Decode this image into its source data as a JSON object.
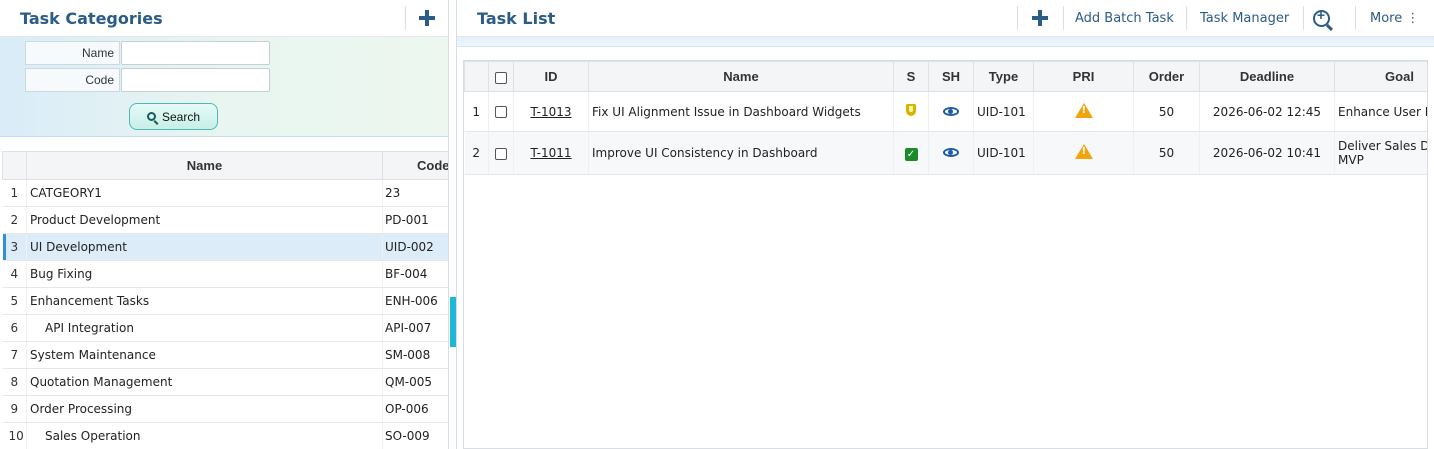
{
  "left_panel": {
    "title": "Task Categories",
    "add_icon": "plus-icon",
    "filters": [
      {
        "label": "Name",
        "value": ""
      },
      {
        "label": "Code",
        "value": ""
      }
    ],
    "search_label": "Search",
    "table": {
      "columns": [
        "Name",
        "Code"
      ],
      "selected_row": 3,
      "rows": [
        {
          "num": "1",
          "name": "CATGEORY1",
          "code": "23"
        },
        {
          "num": "2",
          "name": "Product Development",
          "code": "PD-001"
        },
        {
          "num": "3",
          "name": "UI Development",
          "code": "UID-002"
        },
        {
          "num": "4",
          "name": "Bug Fixing",
          "code": "BF-004"
        },
        {
          "num": "5",
          "name": "Enhancement Tasks",
          "code": "ENH-006"
        },
        {
          "num": "6",
          "name": "API Integration",
          "code": "API-007"
        },
        {
          "num": "7",
          "name": "System Maintenance",
          "code": "SM-008"
        },
        {
          "num": "8",
          "name": "Quotation Management",
          "code": "QM-005"
        },
        {
          "num": "9",
          "name": "Order Processing",
          "code": "OP-006"
        },
        {
          "num": "10",
          "name": "Sales Operation",
          "code": "SO-009"
        }
      ]
    }
  },
  "right_panel": {
    "title": "Task List",
    "toolbar": {
      "add_icon": "plus-icon",
      "add_batch": "Add Batch Task",
      "task_manager": "Task Manager",
      "zoom_icon": "zoom-in-icon",
      "more": "More ⋮"
    },
    "table": {
      "columns": [
        "ID",
        "Name",
        "S",
        "SH",
        "Type",
        "PRI",
        "Order",
        "Deadline",
        "Goal"
      ],
      "rows": [
        {
          "num": "1",
          "id": "T-1013",
          "name": "Fix UI Alignment Issue in Dashboard Widgets",
          "s_icon": "shield-icon",
          "sh_icon": "eye-icon",
          "type": "UID-101",
          "pri_icon": "warning-icon",
          "order": "50",
          "deadline": "2026-06-02 12:45",
          "goal": "Enhance User Ex"
        },
        {
          "num": "2",
          "id": "T-1011",
          "name": "Improve UI Consistency in Dashboard",
          "s_icon": "check-icon",
          "sh_icon": "eye-icon",
          "type": "UID-101",
          "pri_icon": "warning-icon",
          "order": "50",
          "deadline": "2026-06-02 10:41",
          "goal": "Deliver Sales Da MVP"
        }
      ]
    }
  },
  "colors": {
    "title": "#2b5c87",
    "selection": "#dcecf8",
    "splitter": "#1eb7d8",
    "warning": "#f2a40f",
    "status_ok": "#1c8a2a",
    "status_shield": "#d6b400"
  }
}
